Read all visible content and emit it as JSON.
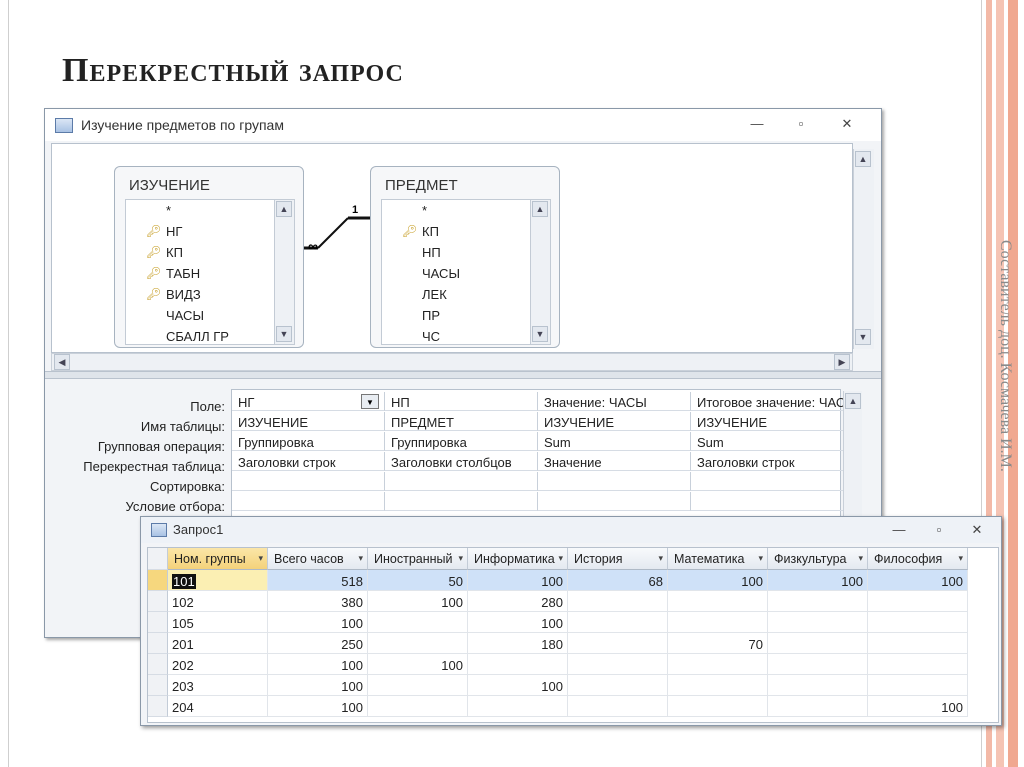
{
  "slide": {
    "title": "Перекрестный запрос",
    "side_credit": "Составитель доц. Космачева И.М."
  },
  "query_window": {
    "title": "Изучение предметов по групам",
    "tables": [
      {
        "name": "ИЗУЧЕНИЕ",
        "fields": [
          "*",
          "НГ",
          "КП",
          "ТАБН",
          "ВИДЗ",
          "ЧАСЫ",
          "СБАЛЛ ГР"
        ],
        "keys": [
          false,
          true,
          true,
          true,
          true,
          false,
          false
        ]
      },
      {
        "name": "ПРЕДМЕТ",
        "fields": [
          "*",
          "КП",
          "НП",
          "ЧАСЫ",
          "ЛЕК",
          "ПР",
          "ЧС"
        ],
        "keys": [
          false,
          true,
          false,
          false,
          false,
          false,
          false
        ]
      }
    ],
    "relation": {
      "many": "∞",
      "one": "1"
    },
    "grid_row_labels": [
      "Поле:",
      "Имя таблицы:",
      "Групповая операция:",
      "Перекрестная таблица:",
      "Сортировка:",
      "Условие отбора:"
    ],
    "grid_columns": [
      [
        "НГ",
        "ИЗУЧЕНИЕ",
        "Группировка",
        "Заголовки строк",
        "",
        ""
      ],
      [
        "НП",
        "ПРЕДМЕТ",
        "Группировка",
        "Заголовки столбцов",
        "",
        ""
      ],
      [
        "Значение: ЧАСЫ",
        "ИЗУЧЕНИЕ",
        "Sum",
        "Значение",
        "",
        ""
      ],
      [
        "Итоговое значение: ЧАСЫ",
        "ИЗУЧЕНИЕ",
        "Sum",
        "Заголовки строк",
        "",
        ""
      ]
    ]
  },
  "result_window": {
    "title": "Запрос1",
    "headers": [
      "Ном. группы",
      "Всего часов",
      "Иностранный",
      "Информатика",
      "История",
      "Математика",
      "Физкультура",
      "Философия"
    ],
    "rows": [
      [
        "101",
        "518",
        "50",
        "100",
        "68",
        "100",
        "100",
        "100"
      ],
      [
        "102",
        "380",
        "100",
        "280",
        "",
        "",
        "",
        ""
      ],
      [
        "105",
        "100",
        "",
        "100",
        "",
        "",
        "",
        ""
      ],
      [
        "201",
        "250",
        "",
        "180",
        "",
        "70",
        "",
        ""
      ],
      [
        "202",
        "100",
        "100",
        "",
        "",
        "",
        "",
        ""
      ],
      [
        "203",
        "100",
        "",
        "100",
        "",
        "",
        "",
        ""
      ],
      [
        "204",
        "100",
        "",
        "",
        "",
        "",
        "",
        "100"
      ]
    ]
  },
  "window_controls": {
    "minimize": "—",
    "restore": "▫",
    "close": "✕"
  }
}
